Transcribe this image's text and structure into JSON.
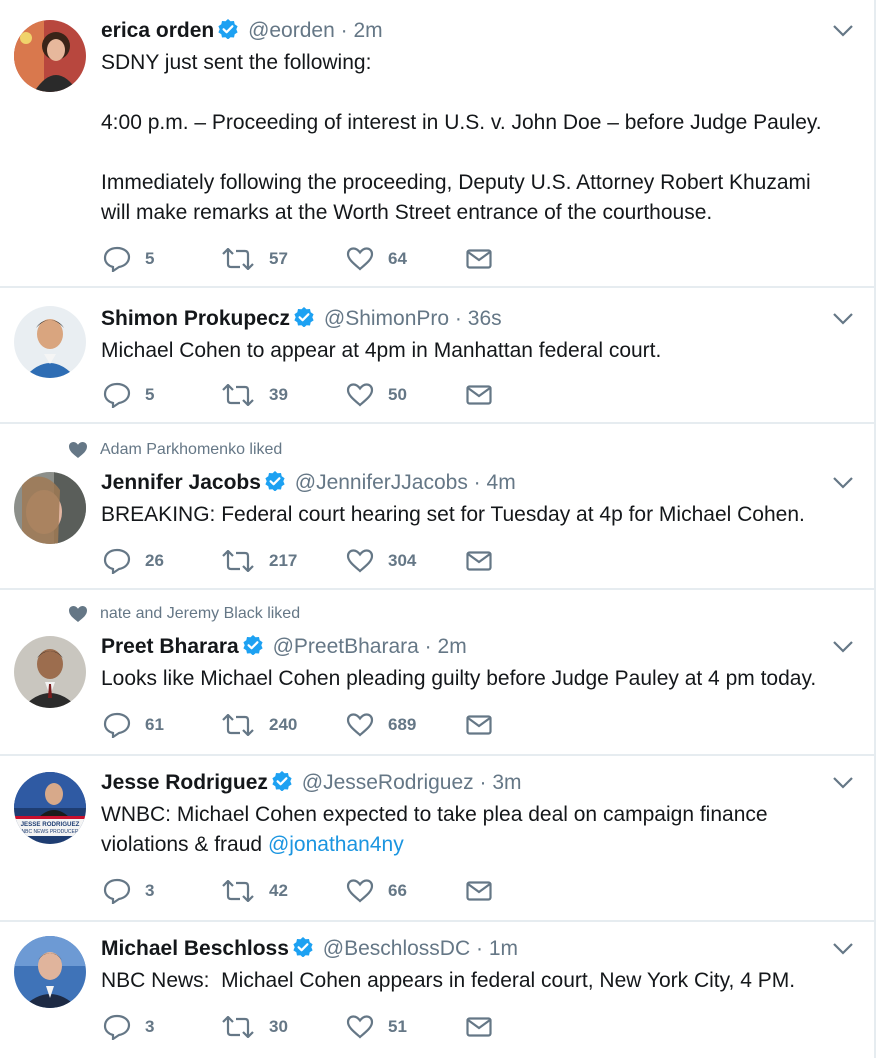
{
  "colors": {
    "verified": "#1da1f2",
    "muted": "#657786",
    "link": "#1b95e0",
    "divider": "#e6ecf0"
  },
  "tweets": [
    {
      "name": "erica orden",
      "handle": "@eorden",
      "dot": "·",
      "time": "2m",
      "social": "",
      "text_lines": [
        "SDNY just sent the following:",
        "",
        "4:00 p.m. – Proceeding of interest in U.S. v. John Doe – before Judge Pauley.",
        "",
        "Immediately following the proceeding, Deputy U.S. Attorney Robert Khuzami",
        "will make remarks at the Worth Street entrance of the courthouse."
      ],
      "link": "",
      "replies": "5",
      "retweets": "57",
      "likes": "64"
    },
    {
      "name": "Shimon Prokupecz",
      "handle": "@ShimonPro",
      "dot": "·",
      "time": "36s",
      "social": "",
      "text_lines": [
        "Michael Cohen to appear at 4pm in Manhattan federal court."
      ],
      "link": "",
      "replies": "5",
      "retweets": "39",
      "likes": "50"
    },
    {
      "name": "Jennifer Jacobs",
      "handle": "@JenniferJJacobs",
      "dot": "·",
      "time": "4m",
      "social": "Adam Parkhomenko liked",
      "text_lines": [
        "BREAKING: Federal court hearing set for Tuesday at 4p for Michael Cohen."
      ],
      "link": "",
      "replies": "26",
      "retweets": "217",
      "likes": "304"
    },
    {
      "name": "Preet Bharara",
      "handle": "@PreetBharara",
      "dot": "·",
      "time": "2m",
      "social": "nate and Jeremy Black liked",
      "text_lines": [
        "Looks like Michael Cohen pleading guilty before Judge Pauley at 4 pm today."
      ],
      "link": "",
      "replies": "61",
      "retweets": "240",
      "likes": "689"
    },
    {
      "name": "Jesse Rodriguez",
      "handle": "@JesseRodriguez",
      "dot": "·",
      "time": "3m",
      "social": "",
      "text_lines": [
        "WNBC: Michael Cohen expected to take plea deal on campaign finance",
        "violations & fraud "
      ],
      "link": "@jonathan4ny",
      "avatar_text": "JESSE RODRIGUEZ NBC NEWS PRODUCER",
      "replies": "3",
      "retweets": "42",
      "likes": "66"
    },
    {
      "name": "Michael Beschloss",
      "handle": "@BeschlossDC",
      "dot": "·",
      "time": "1m",
      "social": "",
      "text_lines": [
        "NBC News:  Michael Cohen appears in federal court, New York City, 4 PM."
      ],
      "link": "",
      "replies": "3",
      "retweets": "30",
      "likes": "51"
    }
  ]
}
